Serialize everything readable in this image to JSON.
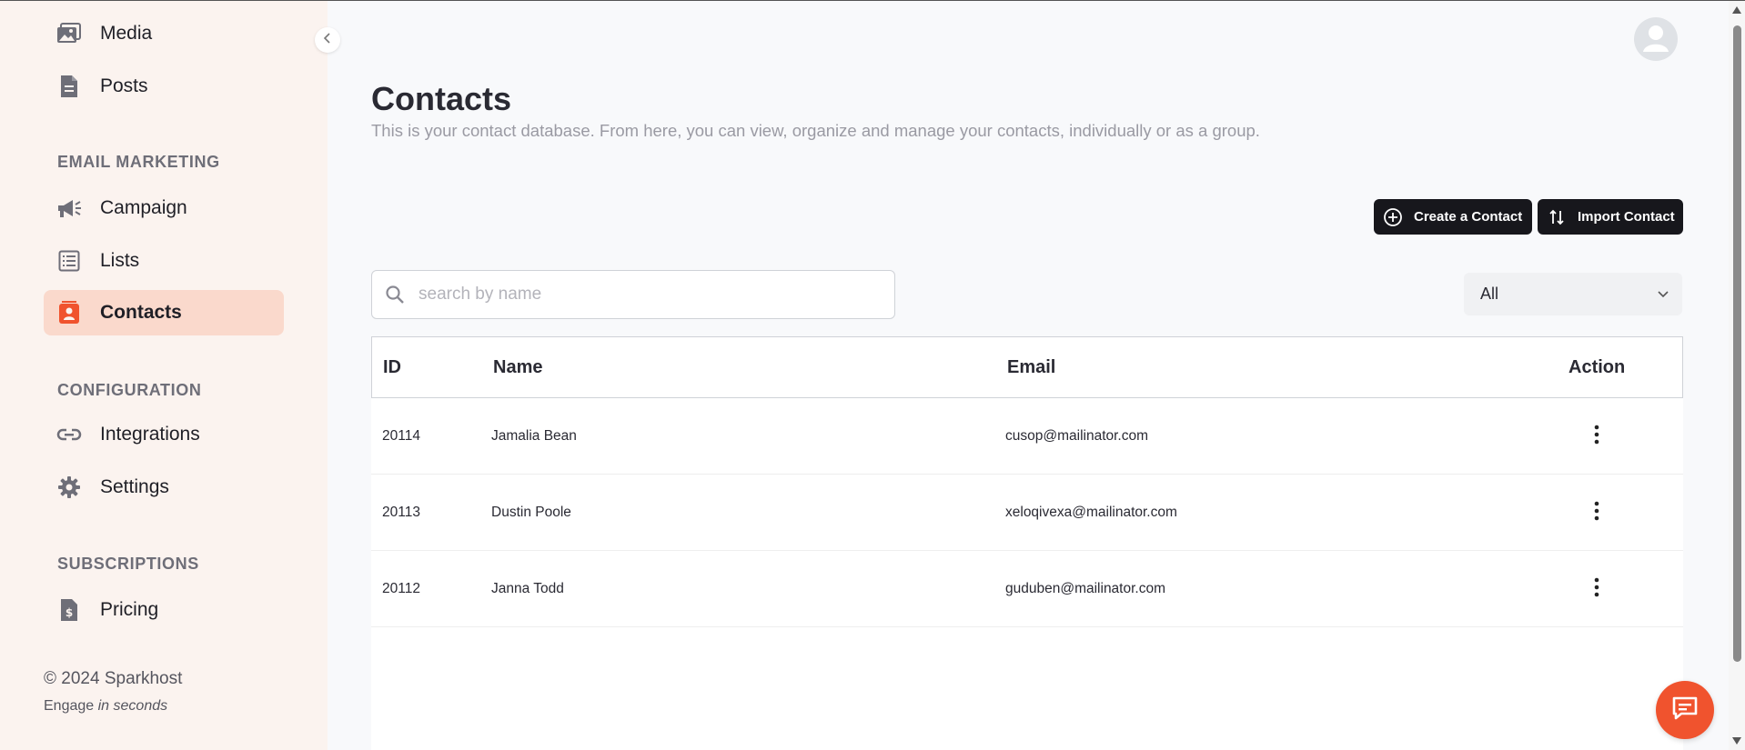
{
  "sidebar": {
    "items": [
      {
        "label": "Media",
        "icon": "image-icon"
      },
      {
        "label": "Posts",
        "icon": "document-icon"
      },
      {
        "label": "Campaign",
        "icon": "megaphone-icon"
      },
      {
        "label": "Lists",
        "icon": "list-icon"
      },
      {
        "label": "Contacts",
        "icon": "contacts-icon",
        "active": true
      },
      {
        "label": "Integrations",
        "icon": "link-icon"
      },
      {
        "label": "Settings",
        "icon": "gear-icon"
      },
      {
        "label": "Pricing",
        "icon": "pricing-icon"
      }
    ],
    "sections": {
      "email_marketing": "EMAIL MARKETING",
      "configuration": "CONFIGURATION",
      "subscriptions": "SUBSCRIPTIONS"
    },
    "footer": {
      "copyright": "© 2024 Sparkhost",
      "tagline_prefix": "Engage",
      "tagline_emphasis": "in seconds"
    }
  },
  "page": {
    "title": "Contacts",
    "description": "This is your contact database. From here, you can view, organize and manage your contacts, individually or as a group."
  },
  "actions": {
    "create_label": "Create a Contact",
    "import_label": "Import Contact"
  },
  "search": {
    "placeholder": "search by name",
    "value": ""
  },
  "filter": {
    "selected": "All"
  },
  "table": {
    "headers": {
      "id": "ID",
      "name": "Name",
      "email": "Email",
      "action": "Action"
    },
    "rows": [
      {
        "id": "20114",
        "name": "Jamalia Bean",
        "email": "cusop@mailinator.com"
      },
      {
        "id": "20113",
        "name": "Dustin Poole",
        "email": "xeloqivexa@mailinator.com"
      },
      {
        "id": "20112",
        "name": "Janna Todd",
        "email": "guduben@mailinator.com"
      }
    ]
  },
  "colors": {
    "accent": "#f0532e",
    "active_bg": "#fad9cc",
    "sidebar_bg": "#fbf3ef",
    "button_dark": "#17171c"
  }
}
